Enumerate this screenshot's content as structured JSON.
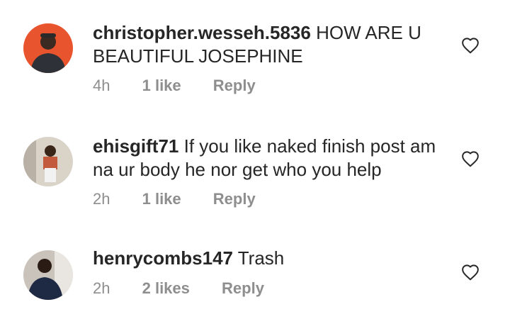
{
  "comments": [
    {
      "username": "christopher.wesseh.5836",
      "text": "HOW ARE U BEAUTIFUL JOSEPHINE",
      "time": "4h",
      "likes": "1 like",
      "reply": "Reply",
      "avatar_bg": "#e8542e"
    },
    {
      "username": "ehisgift71",
      "text": "If you like naked finish post am na ur body he nor get who you help",
      "time": "2h",
      "likes": "1 like",
      "reply": "Reply",
      "avatar_bg": "#d9d3c8"
    },
    {
      "username": "henrycombs147",
      "text": "Trash",
      "time": "2h",
      "likes": "2 likes",
      "reply": "Reply",
      "avatar_bg": "#c9c3bb"
    }
  ],
  "icons": {
    "like": "heart-outline-icon"
  },
  "colors": {
    "text": "#262626",
    "meta": "#8e8e8e",
    "icon": "#262626"
  }
}
